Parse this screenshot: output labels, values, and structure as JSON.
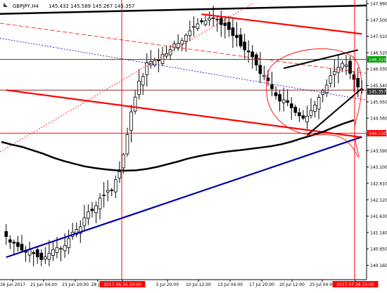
{
  "header": {
    "symbol_label": "GBPJPY,H4",
    "ohlc_label": "145.432 145.589 145.267 145.357"
  },
  "colors": {
    "background": "#ffffff",
    "candle": "#000000",
    "ma_line": "#000000",
    "trend_red": "#ff0000",
    "trend_blue": "#0000aa",
    "level_green": "#008000",
    "level_brown": "#8b2a2a",
    "price_tag_red": "#ff0000",
    "price_tag_green": "#00a000",
    "price_tag_dark": "#303030"
  },
  "chart_data": {
    "type": "candlestick",
    "symbol": "GBPJPY",
    "timeframe": "H4",
    "last_bar": {
      "open": 145.432,
      "high": 145.589,
      "low": 145.267,
      "close": 145.357
    },
    "ylim": [
      139.73,
      148.01
    ],
    "y_ticks": [
      "147.990",
      "147.500",
      "147.010",
      "146.520",
      "146.030",
      "145.540",
      "145.050",
      "144.560",
      "144.070",
      "143.590",
      "143.100",
      "142.610",
      "142.120",
      "141.630",
      "141.140",
      "140.650",
      "140.160",
      "139.670"
    ],
    "x_ticks": [
      "16 Jun 2017",
      "21 Jun 04:00",
      "23 Jun 20:00",
      "28 Jun",
      "2017.06.30 20:00",
      "5 Jul 20:00",
      "10 Jul 12:00",
      "13 Jul 04:00",
      "17 Jul 20:00",
      "20 Jul 12:00",
      "25 Jul 04:00",
      "2017.07.28 23:00"
    ],
    "price_labels": [
      {
        "text": "146.319",
        "value": 146.319,
        "style": "green"
      },
      {
        "text": "145.357",
        "value": 145.357,
        "style": "dark"
      },
      {
        "text": "144.110",
        "value": 144.11,
        "style": "red"
      }
    ],
    "grid": false,
    "series": [
      {
        "type": "candles",
        "close": [
          141.02,
          140.85,
          140.82,
          140.72,
          140.61,
          140.55,
          140.62,
          140.51,
          140.41,
          140.33,
          140.42,
          140.52,
          140.63,
          140.69,
          140.66,
          140.75,
          140.96,
          141.15,
          141.23,
          141.31,
          141.58,
          141.76,
          141.79,
          141.94,
          142.17,
          142.26,
          142.4,
          142.39,
          142.72,
          142.96,
          143.47,
          144.07,
          144.75,
          145.19,
          145.67,
          145.81,
          146.22,
          146.26,
          146.29,
          146.28,
          146.47,
          146.49,
          146.61,
          146.78,
          146.8,
          146.88,
          147.04,
          147.17,
          147.3,
          147.38,
          147.44,
          147.47,
          147.55,
          147.54,
          147.51,
          147.36,
          147.33,
          147.21,
          147.03,
          146.97,
          146.72,
          146.6,
          146.54,
          146.4,
          146.15,
          145.89,
          145.84,
          145.68,
          145.44,
          145.23,
          145.07,
          145.11,
          145.03,
          144.87,
          144.73,
          144.63,
          144.56,
          144.62,
          144.79,
          144.95,
          145.18,
          145.38,
          145.55,
          145.83,
          145.96,
          146.08,
          146.2,
          146.15,
          145.9,
          145.72,
          145.49,
          145.39
        ]
      },
      {
        "type": "line",
        "name": "moving_average",
        "color": "black"
      }
    ],
    "annotations": {
      "horizontal_lines": [
        {
          "value": 147.93,
          "color": "black"
        },
        {
          "value": 146.319,
          "color": "green"
        },
        {
          "value": 145.4,
          "color": "brown"
        },
        {
          "value": 144.11,
          "color": "red"
        }
      ],
      "trendlines": [
        {
          "color": "red",
          "from": {
            "bar": 0,
            "price": 145.4
          },
          "to": {
            "bar": 91,
            "price": 143.99
          }
        },
        {
          "color": "red",
          "from": {
            "bar": 50,
            "price": 147.67
          },
          "to": {
            "bar": 91,
            "price": 147.08
          }
        },
        {
          "color": "blue",
          "from": {
            "bar": 0,
            "price": 140.4
          },
          "to": {
            "bar": 91,
            "price": 144.0
          }
        },
        {
          "color": "black",
          "from": {
            "bar": 77,
            "price": 144.05
          },
          "to": {
            "bar": 91,
            "price": 145.45
          }
        },
        {
          "color": "black",
          "from": {
            "bar": 71,
            "price": 146.05
          },
          "to": {
            "bar": 90,
            "price": 146.6
          }
        }
      ],
      "vertical_markers": [
        "2017.06.30 20:00",
        "2017.07.28 23:00"
      ],
      "freehand_circle": "red"
    }
  }
}
